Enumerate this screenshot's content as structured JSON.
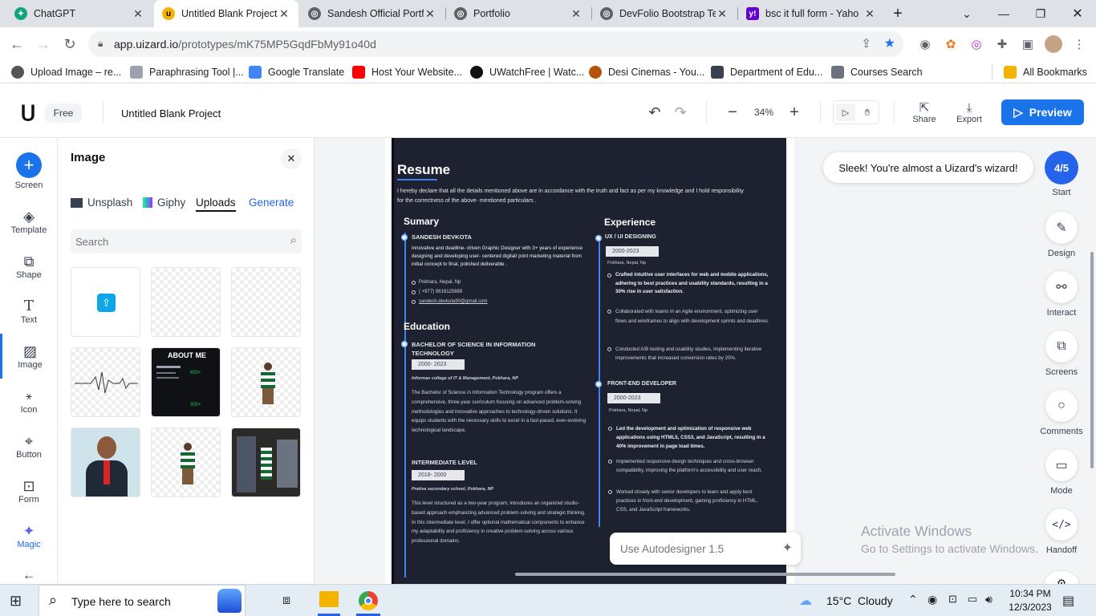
{
  "browser": {
    "tabs": [
      {
        "title": "ChatGPT",
        "icon": "chatgpt-icon",
        "active": false
      },
      {
        "title": "Untitled Blank Project",
        "icon": "uizard-icon",
        "active": true
      },
      {
        "title": "Sandesh Official Portf",
        "icon": "globe-icon",
        "active": false
      },
      {
        "title": "Portfolio",
        "icon": "globe-icon",
        "active": false
      },
      {
        "title": "DevFolio Bootstrap Te",
        "icon": "globe-icon",
        "active": false
      },
      {
        "title": "bsc it full form - Yaho",
        "icon": "yahoo-icon",
        "active": false
      }
    ],
    "new_tab": "+",
    "url_host": "app.uizard.io",
    "url_path": "/prototypes/mK75MP5GqdFbMy91o40d",
    "bookmarks": [
      {
        "label": "Upload Image – re...",
        "icon": "mustache-icon"
      },
      {
        "label": "Paraphrasing Tool |...",
        "icon": "feather-icon"
      },
      {
        "label": "Google Translate",
        "icon": "translate-icon"
      },
      {
        "label": "Host Your Website...",
        "icon": "youtube-icon"
      },
      {
        "label": "UWatchFree | Watc...",
        "icon": "play-icon"
      },
      {
        "label": "Desi Cinemas - You...",
        "icon": "cinema-icon"
      },
      {
        "label": "Department of Edu...",
        "icon": "emblem-icon"
      },
      {
        "label": "Courses Search",
        "icon": "cap-icon"
      }
    ],
    "all_bookmarks": "All Bookmarks"
  },
  "app": {
    "plan": "Free",
    "project_name": "Untitled Blank Project",
    "zoom": "34%",
    "share": "Share",
    "export": "Export",
    "preview": "Preview"
  },
  "rail": [
    {
      "label": "Screen",
      "icon": "plus-icon"
    },
    {
      "label": "Template",
      "icon": "layers-icon"
    },
    {
      "label": "Shape",
      "icon": "shape-icon"
    },
    {
      "label": "Text",
      "icon": "text-icon"
    },
    {
      "label": "Image",
      "icon": "image-icon"
    },
    {
      "label": "Icon",
      "icon": "icon-grid-icon"
    },
    {
      "label": "Button",
      "icon": "button-icon"
    },
    {
      "label": "Form",
      "icon": "form-icon"
    },
    {
      "label": "Magic",
      "icon": "sparkle-icon"
    }
  ],
  "panel": {
    "title": "Image",
    "sources": [
      "Unsplash",
      "Giphy",
      "Uploads",
      "Generate"
    ],
    "search_placeholder": "Search",
    "thumb_about_text": "ABOUT ME",
    "thumb_stat_1": "650+",
    "thumb_stat_2": "300+"
  },
  "resume": {
    "title": "Resume",
    "intro": "I hereby declare that all the details mentioned above are in accordance with the truth and fact as per my knowledge and I hold responsibility for the correctness of the above- mentioned particulars .",
    "summary_heading": "Sumary",
    "name": "SANDESH DEVKOTA",
    "summary_text": "Innovative and deadline- driven Graphic Designer with 3+ years of experience designing and developing user- centered digital/ print marketing material from initial concept to final, polished deliverable .",
    "contact": [
      "Pokhara, Nepal, Np",
      "( +977) 9816125889",
      "sandesh.devkota90@gmail.com"
    ],
    "education_heading": "Education",
    "edu1_title": "BACHELOR OF SCIENCE IN INFORMATION TECHNOLOGY",
    "edu1_date": "2000- 2023",
    "edu1_school": "Informax college of IT & Management, Pokhara, NP",
    "edu1_text": "The Bachelor of Science in Information Technology program offers a comprehensive, three-year curriculum focusing on advanced problem-solving methodologies and innovative approaches to technology-driven solutions. It equips students with the necessary skills to excel in a fast-paced, ever-evolving technological landscape.",
    "edu2_title": "INTERMEDIATE LEVEL",
    "edu2_date": "2018- 2000",
    "edu2_school": "Prativa secondary school, Pokhara, NP",
    "edu2_text": "This level structured as a two-year program, introduces an organized studio-based approach emphasizing advanced problem-solving and strategic thinking. In this intermediate level, I offer optional mathematical components to enhance my adaptability and proficiency in creative problem-solving across various professional domains.",
    "experience_heading": "Experience",
    "exp1_title": "UX / UI DESIGNING",
    "exp1_date": "2000-2023",
    "exp1_loc": "Pokhara, Nepal, Np",
    "exp1_items": [
      "Crafted intuitive user interfaces for web and mobile applications, adhering to best practices and usability standards, resulting in a 30% rise in user satisfaction.",
      "Collaborated with teams in an Agile environment, optimizing user flows and wireframes to align with development sprints and deadlines.",
      "Conducted A/B testing and usability studies, implementing iterative improvements that increased conversion rates by 20%."
    ],
    "exp2_title": "FRONT-END DEVELOPER",
    "exp2_date": "2000-2023",
    "exp2_loc": "Pokhara, Nepal, Np",
    "exp2_items": [
      "Led the development and optimization of responsive web applications using HTML5, CSS3, and JavaScript, resulting in a 40% improvement in page load times.",
      "Implemented responsive design techniques and cross-browser compatibility, improving the platform's accessibility and user reach.",
      "Worked closely with senior developers to learn and apply best practices in front-end development, gaining proficiency in HTML, CSS, and JavaScript frameworks."
    ]
  },
  "onboarding": {
    "toast": "Sleek! You're almost a Uizard's wizard!",
    "progress": "4/5",
    "start": "Start"
  },
  "right_rail": [
    "Design",
    "Interact",
    "Screens",
    "Comments",
    "Mode",
    "Handoff"
  ],
  "autodesigner_placeholder": "Use Autodesigner 1.5",
  "watermark": {
    "line1": "Activate Windows",
    "line2": "Go to Settings to activate Windows."
  },
  "taskbar": {
    "search_placeholder": "Type here to search",
    "weather": "15°C  Cloudy",
    "time": "10:34 PM",
    "date": "12/3/2023"
  }
}
